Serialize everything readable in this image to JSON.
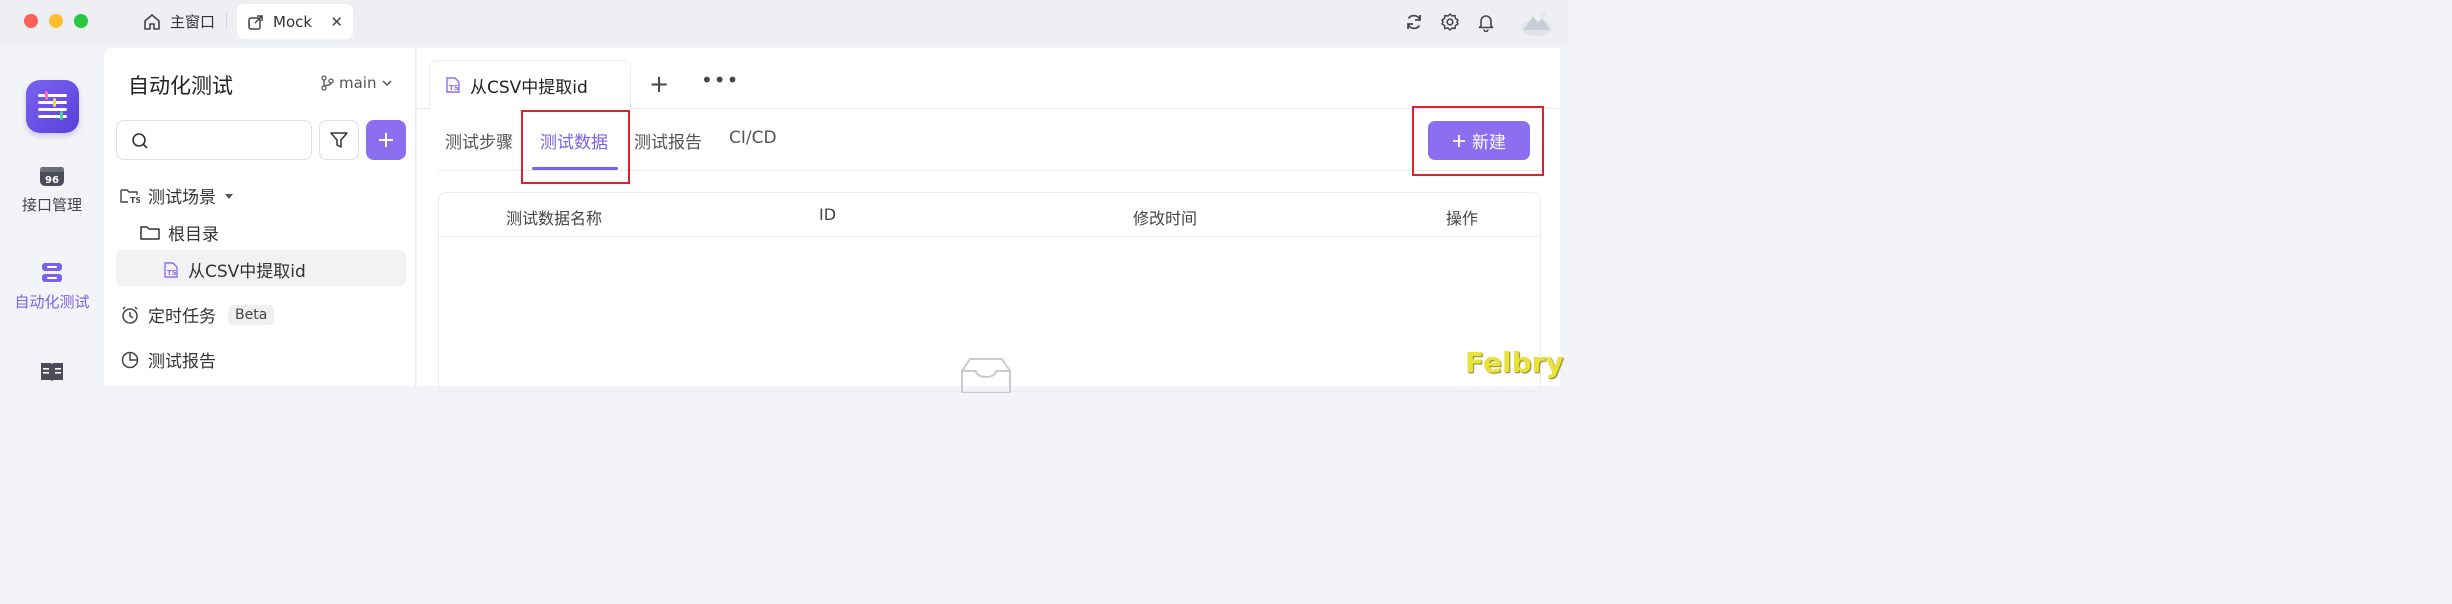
{
  "titlebar": {
    "tabs": [
      {
        "label": "主窗口",
        "icon": "home-icon"
      },
      {
        "label": "Mock",
        "icon": "external-link-icon",
        "close": "✕"
      }
    ],
    "icons": [
      "refresh-icon",
      "settings-icon",
      "bell-icon",
      "avatar"
    ]
  },
  "rail": {
    "items": [
      {
        "label": "接口管理",
        "icon": "api-icon"
      },
      {
        "label": "自动化测试",
        "icon": "automation-icon",
        "active": true
      },
      {
        "label": "",
        "icon": "book-icon"
      }
    ]
  },
  "sidebar": {
    "title": "自动化测试",
    "branch": "main",
    "search": {
      "placeholder": "",
      "value": ""
    },
    "tree": {
      "scenarios_label": "测试场景",
      "root_label": "根目录",
      "item_label": "从CSV中提取id",
      "scheduled_label": "定时任务",
      "beta_badge": "Beta",
      "reports_label": "测试报告"
    }
  },
  "main": {
    "doc_tab": "从CSV中提取id",
    "subtabs": [
      "测试步骤",
      "测试数据",
      "测试报告",
      "CI/CD"
    ],
    "active_subtab": "测试数据",
    "new_button": "新建",
    "table": {
      "columns": [
        "测试数据名称",
        "ID",
        "修改时间",
        "操作"
      ],
      "rows": []
    }
  },
  "watermark": "Felbry",
  "colors": {
    "accent": "#8b6ff0",
    "accent_text": "#7b61e8",
    "annotation": "#e0202c"
  }
}
